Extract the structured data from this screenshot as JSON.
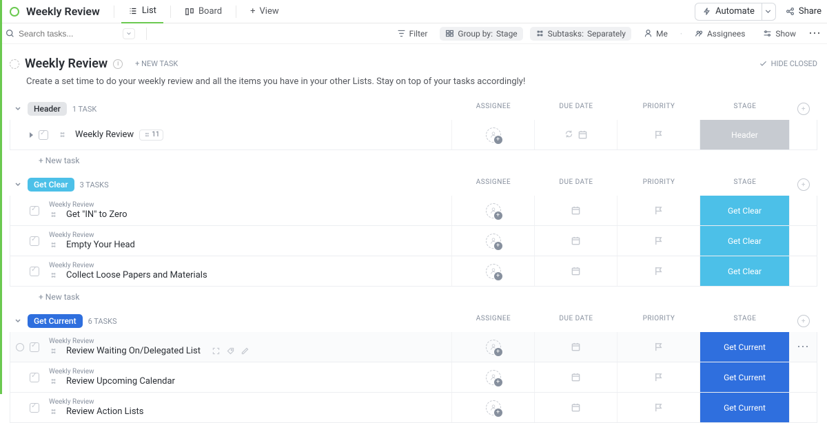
{
  "header": {
    "title": "Weekly Review",
    "tabs": {
      "list": "List",
      "board": "Board",
      "view": "View"
    },
    "automate": "Automate",
    "share": "Share"
  },
  "filterbar": {
    "search_placeholder": "Search tasks...",
    "filter": "Filter",
    "groupby_label": "Group by:",
    "groupby_value": "Stage",
    "subtasks_label": "Subtasks:",
    "subtasks_value": "Separately",
    "me": "Me",
    "assignees": "Assignees",
    "show": "Show"
  },
  "list": {
    "name": "Weekly Review",
    "new_task": "+ NEW TASK",
    "hide_closed": "HIDE CLOSED",
    "description": "Create a set time to do your weekly review and all the items you have in your other Lists. Stay on top of your tasks accordingly!",
    "columns": {
      "assignee": "Assignee",
      "due": "Due date",
      "priority": "Priority",
      "stage": "Stage"
    },
    "add_task": "+ New task"
  },
  "groups": [
    {
      "id": "header",
      "pill": "Header",
      "pill_class": "pill-header",
      "count": "1 TASK",
      "rows": [
        {
          "name": "Weekly Review",
          "subtasks": "11",
          "has_triangle": true,
          "has_recur": true,
          "stage": "Header",
          "stage_class": "sc-header"
        }
      ],
      "show_new": true
    },
    {
      "id": "getclear",
      "pill": "Get Clear",
      "pill_class": "pill-getclear",
      "count": "3 TASKS",
      "rows": [
        {
          "parent": "Weekly Review",
          "name": "Get \"IN\" to Zero",
          "stage": "Get Clear",
          "stage_class": "sc-getclear"
        },
        {
          "parent": "Weekly Review",
          "name": "Empty Your Head",
          "stage": "Get Clear",
          "stage_class": "sc-getclear"
        },
        {
          "parent": "Weekly Review",
          "name": "Collect Loose Papers and Materials",
          "stage": "Get Clear",
          "stage_class": "sc-getclear"
        }
      ],
      "show_new": true
    },
    {
      "id": "getcurrent",
      "pill": "Get Current",
      "pill_class": "pill-getcurrent",
      "count": "6 TASKS",
      "rows": [
        {
          "parent": "Weekly Review",
          "name": "Review Waiting On/Delegated List",
          "hover": true,
          "extra_icons": true,
          "stage": "Get Current",
          "stage_class": "sc-getcurrent"
        },
        {
          "parent": "Weekly Review",
          "name": "Review Upcoming Calendar",
          "stage": "Get Current",
          "stage_class": "sc-getcurrent"
        },
        {
          "parent": "Weekly Review",
          "name": "Review Action Lists",
          "stage": "Get Current",
          "stage_class": "sc-getcurrent"
        }
      ],
      "show_new": false
    }
  ]
}
